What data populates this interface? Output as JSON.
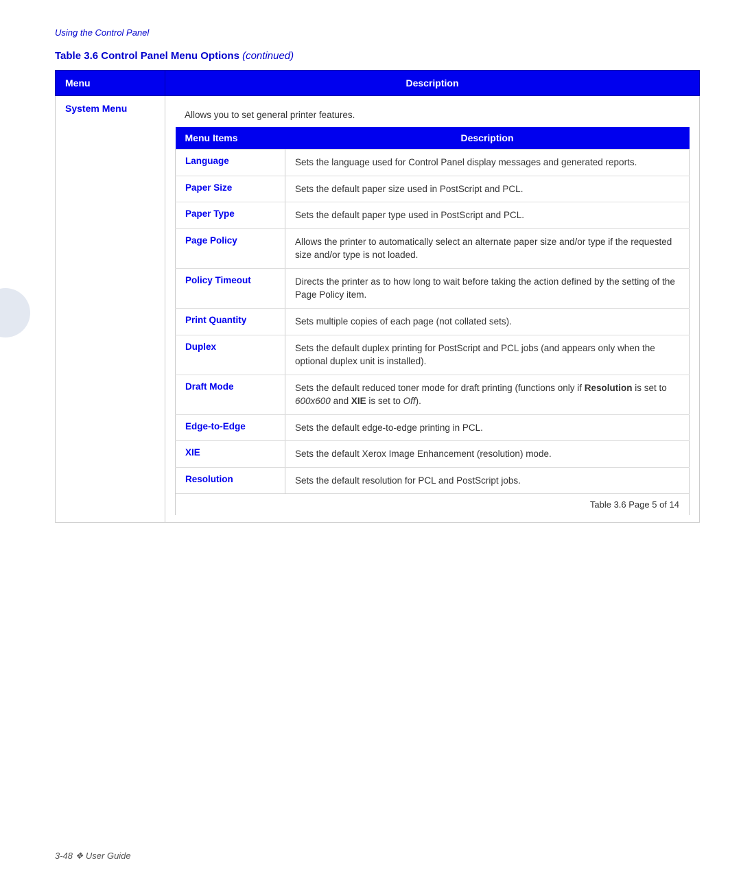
{
  "page": {
    "subtitle": "Using the Control Panel",
    "table_title": "Table 3.6    Control Panel Menu Options",
    "table_title_continued": "(continued)",
    "footer_label": "3-48  ❖   User Guide",
    "page_ref": "Table 3.6  Page 5 of 14"
  },
  "header_row": {
    "menu_col": "Menu",
    "description_col": "Description"
  },
  "system_menu": {
    "label": "System Menu",
    "intro": "Allows you to set general printer features.",
    "inner_header": {
      "items_col": "Menu Items",
      "description_col": "Description"
    },
    "items": [
      {
        "name": "Language",
        "description": "Sets the language used for Control Panel display messages and generated reports."
      },
      {
        "name": "Paper Size",
        "description": "Sets the default paper size used in PostScript and PCL."
      },
      {
        "name": "Paper Type",
        "description": "Sets the default paper type used in PostScript and PCL."
      },
      {
        "name": "Page Policy",
        "description": "Allows the printer to automatically select an alternate paper size and/or type if the requested size and/or type is not loaded."
      },
      {
        "name": "Policy Timeout",
        "description": "Directs the printer as to how long to wait before taking the action defined by the setting of the Page Policy item."
      },
      {
        "name": "Print Quantity",
        "description": "Sets multiple copies of each page (not collated sets)."
      },
      {
        "name": "Duplex",
        "description": "Sets the default duplex printing for PostScript and PCL jobs (and appears only when the optional duplex unit is installed)."
      },
      {
        "name": "Draft Mode",
        "description_parts": [
          {
            "text": "Sets the default reduced toner mode for draft printing (functions only if ",
            "bold": false
          },
          {
            "text": "Resolution",
            "bold": true
          },
          {
            "text": " is set to ",
            "bold": false
          },
          {
            "text": "600x600",
            "italic": true
          },
          {
            "text": " and ",
            "bold": false
          },
          {
            "text": "XIE",
            "bold": true
          },
          {
            "text": " is set to ",
            "bold": false
          },
          {
            "text": "Off",
            "italic": true
          },
          {
            "text": ").",
            "bold": false
          }
        ],
        "description": "Sets the default reduced toner mode for draft printing (functions only if Resolution is set to 600x600 and XIE is set to Off)."
      },
      {
        "name": "Edge-to-Edge",
        "description": "Sets the default edge-to-edge printing in PCL."
      },
      {
        "name": "XIE",
        "description": "Sets the default Xerox Image Enhancement (resolution) mode."
      },
      {
        "name": "Resolution",
        "description": "Sets the default resolution for PCL and PostScript jobs."
      }
    ]
  }
}
